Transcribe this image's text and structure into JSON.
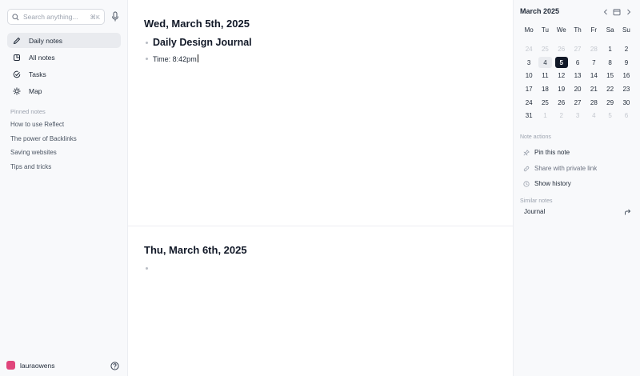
{
  "sidebar": {
    "search_placeholder": "Search anything...",
    "search_shortcut": "⌘K",
    "nav": [
      {
        "label": "Daily notes",
        "icon": "pencil-icon",
        "active": true
      },
      {
        "label": "All notes",
        "icon": "notes-icon"
      },
      {
        "label": "Tasks",
        "icon": "check-circle-icon"
      },
      {
        "label": "Map",
        "icon": "sun-network-icon"
      }
    ],
    "pinned_title": "Pinned notes",
    "pinned": [
      "How to use Reflect",
      "The power of Backlinks",
      "Saving websites",
      "Tips and tricks"
    ],
    "user": "lauraowens"
  },
  "main": {
    "day1": {
      "date": "Wed, March 5th, 2025",
      "heading": "Daily Design Journal",
      "line": "Time: 8:42pm"
    },
    "day2": {
      "date": "Thu, March 6th, 2025"
    }
  },
  "calendar": {
    "month": "March 2025",
    "weekdays": [
      "Mo",
      "Tu",
      "We",
      "Th",
      "Fr",
      "Sa",
      "Su"
    ],
    "days": [
      {
        "d": "24",
        "m": true
      },
      {
        "d": "25",
        "m": true
      },
      {
        "d": "26",
        "m": true
      },
      {
        "d": "27",
        "m": true
      },
      {
        "d": "28",
        "m": true
      },
      {
        "d": "1"
      },
      {
        "d": "2"
      },
      {
        "d": "3"
      },
      {
        "d": "4",
        "today": true
      },
      {
        "d": "5",
        "sel": true
      },
      {
        "d": "6"
      },
      {
        "d": "7"
      },
      {
        "d": "8"
      },
      {
        "d": "9"
      },
      {
        "d": "10"
      },
      {
        "d": "11"
      },
      {
        "d": "12"
      },
      {
        "d": "13"
      },
      {
        "d": "14"
      },
      {
        "d": "15"
      },
      {
        "d": "16"
      },
      {
        "d": "17"
      },
      {
        "d": "18"
      },
      {
        "d": "19"
      },
      {
        "d": "20"
      },
      {
        "d": "21"
      },
      {
        "d": "22"
      },
      {
        "d": "23"
      },
      {
        "d": "24"
      },
      {
        "d": "25"
      },
      {
        "d": "26"
      },
      {
        "d": "27"
      },
      {
        "d": "28"
      },
      {
        "d": "29"
      },
      {
        "d": "30"
      },
      {
        "d": "31"
      },
      {
        "d": "1",
        "m": true
      },
      {
        "d": "2",
        "m": true
      },
      {
        "d": "3",
        "m": true
      },
      {
        "d": "4",
        "m": true
      },
      {
        "d": "5",
        "m": true
      },
      {
        "d": "6",
        "m": true
      }
    ]
  },
  "note_actions": {
    "title": "Note actions",
    "pin": "Pin this note",
    "share": "Share with private link",
    "history": "Show history"
  },
  "similar": {
    "title": "Similar notes",
    "items": [
      "Journal"
    ]
  },
  "colors": {
    "accent": "#111827",
    "avatar": "#e0457b",
    "sidebar_bg": "#f8f9fb"
  }
}
